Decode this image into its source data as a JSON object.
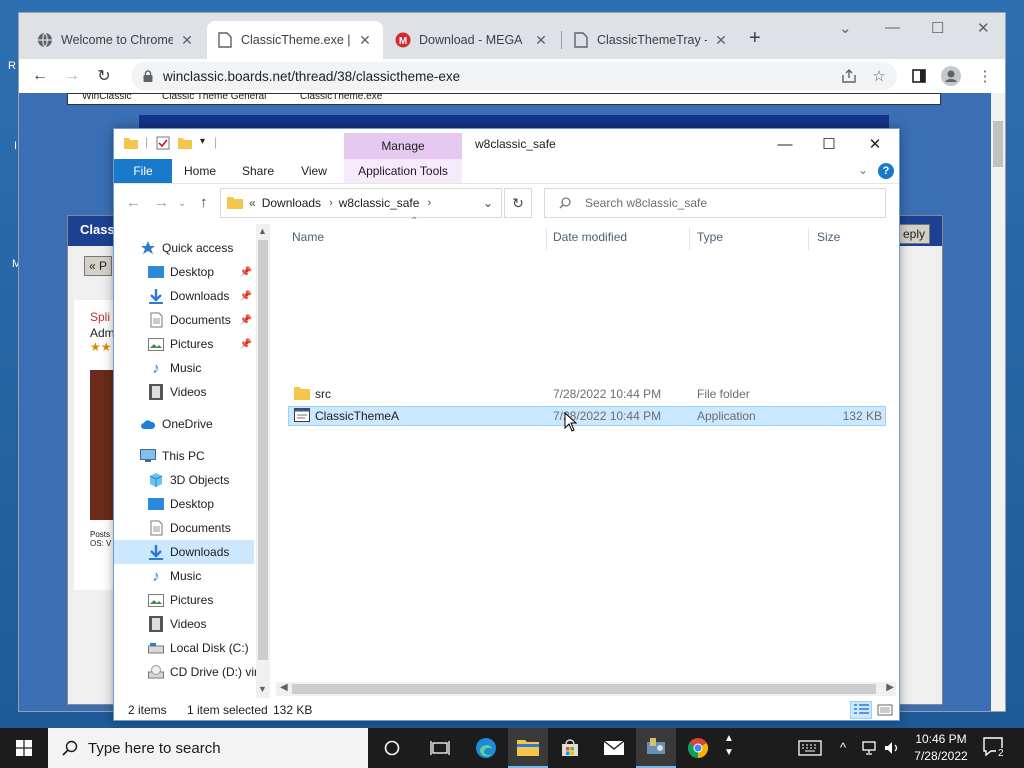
{
  "desktop": {
    "fragments": [
      "R",
      "I",
      "M"
    ]
  },
  "browser": {
    "tabs": [
      {
        "label": "Welcome to Chrome",
        "icon": "globe-icon"
      },
      {
        "label": "ClassicTheme.exe | W",
        "icon": "page-icon"
      },
      {
        "label": "Download - MEGA",
        "icon": "mega-icon"
      },
      {
        "label": "ClassicThemeTray - g",
        "icon": "page-icon"
      }
    ],
    "url": "winclassic.boards.net/thread/38/classictheme-exe",
    "page": {
      "breadcrumb": [
        "WinClassic",
        "Classic Theme General",
        "ClassicTheme.exe"
      ],
      "panel_title": "Classi",
      "reply_label": "eply",
      "pager_label": "« P",
      "post_author": "Spli",
      "post_role": "Adm",
      "post_footer": "Posts\nOS: V"
    }
  },
  "explorer": {
    "title": "w8classic_safe",
    "manage_label": "Manage",
    "ribbon": {
      "file": "File",
      "home": "Home",
      "share": "Share",
      "view": "View",
      "app_tools": "Application Tools"
    },
    "address": {
      "overflow": "«",
      "crumbs": [
        "Downloads",
        "w8classic_safe"
      ]
    },
    "search_placeholder": "Search w8classic_safe",
    "nav": [
      {
        "label": "Quick access",
        "icon": "star-icon",
        "pinned": false
      },
      {
        "label": "Desktop",
        "icon": "desktop-icon",
        "pinned": true
      },
      {
        "label": "Downloads",
        "icon": "download-icon",
        "pinned": true
      },
      {
        "label": "Documents",
        "icon": "document-icon",
        "pinned": true
      },
      {
        "label": "Pictures",
        "icon": "picture-icon",
        "pinned": true
      },
      {
        "label": "Music",
        "icon": "music-icon",
        "pinned": false
      },
      {
        "label": "Videos",
        "icon": "video-icon",
        "pinned": false
      },
      {
        "label": "OneDrive",
        "icon": "cloud-icon",
        "pinned": false
      },
      {
        "label": "This PC",
        "icon": "computer-icon",
        "pinned": false
      },
      {
        "label": "3D Objects",
        "icon": "cube-icon",
        "pinned": false
      },
      {
        "label": "Desktop",
        "icon": "desktop-icon",
        "pinned": false
      },
      {
        "label": "Documents",
        "icon": "document-icon",
        "pinned": false
      },
      {
        "label": "Downloads",
        "icon": "download-icon",
        "pinned": false,
        "selected": true
      },
      {
        "label": "Music",
        "icon": "music-icon",
        "pinned": false
      },
      {
        "label": "Pictures",
        "icon": "picture-icon",
        "pinned": false
      },
      {
        "label": "Videos",
        "icon": "video-icon",
        "pinned": false
      },
      {
        "label": "Local Disk (C:)",
        "icon": "drive-icon",
        "pinned": false
      },
      {
        "label": "CD Drive (D:) virt",
        "icon": "cd-drive-icon",
        "pinned": false
      }
    ],
    "columns": [
      "Name",
      "Date modified",
      "Type",
      "Size"
    ],
    "files": [
      {
        "name": "src",
        "date": "7/28/2022 10:44 PM",
        "type": "File folder",
        "size": "",
        "icon": "folder-icon"
      },
      {
        "name": "ClassicThemeA",
        "date": "7/28/2022 10:44 PM",
        "type": "Application",
        "size": "132 KB",
        "icon": "application-icon",
        "selected": true
      }
    ],
    "status": {
      "items": "2 items",
      "selected": "1 item selected",
      "size": "132 KB"
    }
  },
  "taskbar": {
    "search_placeholder": "Type here to search",
    "time": "10:46 PM",
    "date": "7/28/2022",
    "notifications": "2"
  },
  "colors": {
    "accent": "#1979ca",
    "selection": "#cce8ff",
    "manage": "#e7c8f0"
  }
}
